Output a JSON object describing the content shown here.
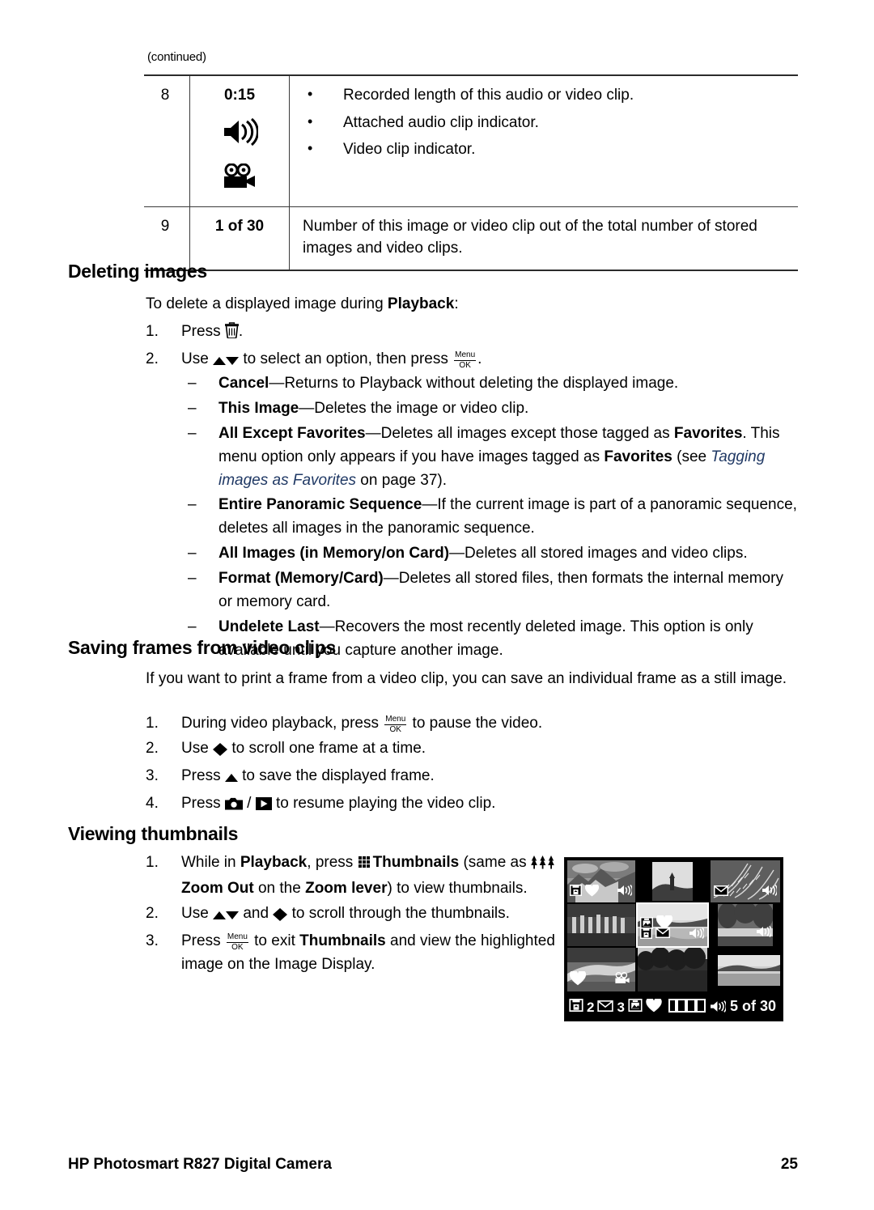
{
  "page": {
    "continued_label": "(continued)",
    "number": "25",
    "footer_title": "HP Photosmart R827 Digital Camera"
  },
  "table": {
    "rows": [
      {
        "num": "8",
        "value": "0:15",
        "icons": [
          "speaker-icon",
          "video-camera-icon"
        ],
        "bullets": [
          "Recorded length of this audio or video clip.",
          "Attached audio clip indicator.",
          "Video clip indicator."
        ]
      },
      {
        "num": "9",
        "value": "1 of 30",
        "icons": [],
        "description": "Number of this image or video clip out of the total number of stored images and video clips."
      }
    ]
  },
  "deleting_images": {
    "heading": "Deleting images",
    "intro_a": "To delete a displayed image during ",
    "intro_b": "Playback",
    "intro_c": ":",
    "steps": [
      {
        "num": "1.",
        "a": "Press ",
        "icon": "trash-icon",
        "b": "."
      },
      {
        "num": "2.",
        "a": "Use ",
        "icons": "up-down-arrows-icon",
        "b": " to select an option, then press ",
        "icon2": "menu-ok-icon",
        "c": "."
      }
    ],
    "options": [
      {
        "term": "Cancel",
        "dash": "—",
        "desc": "Returns to Playback without deleting the displayed image."
      },
      {
        "term": "This Image",
        "dash": "—",
        "desc": "Deletes the image or video clip."
      },
      {
        "term": "All Except Favorites",
        "dash": "—",
        "desc_a": "Deletes all images except those tagged as ",
        "bold_a": "Favorites",
        "desc_b": ". This menu option only appears if you have images tagged as ",
        "bold_b": "Favorites",
        "desc_c": " (see ",
        "link": "Tagging images as Favorites",
        "desc_d": " on page 37).",
        "link_page": "37"
      },
      {
        "term": "Entire Panoramic Sequence",
        "dash": "—",
        "desc": "If the current image is part of a panoramic sequence, deletes all images in the panoramic sequence."
      },
      {
        "term": "All Images (in Memory/on Card)",
        "dash": "—",
        "desc": "Deletes all stored images and video clips."
      },
      {
        "term": "Format (Memory/Card)",
        "dash": "—",
        "desc": "Deletes all stored files, then formats the internal memory or memory card."
      },
      {
        "term": "Undelete Last",
        "dash": "—",
        "desc": "Recovers the most recently deleted image. This option is only available until you capture another image."
      }
    ]
  },
  "saving_frames": {
    "heading": "Saving frames from video clips",
    "intro": "If you want to print a frame from a video clip, you can save an individual frame as a still image.",
    "steps": [
      {
        "num": "1.",
        "a": "During video playback, press ",
        "icon": "menu-ok-icon",
        "b": " to pause the video."
      },
      {
        "num": "2.",
        "a": "Use ",
        "icon": "left-right-arrows-icon",
        "b": " to scroll one frame at a time."
      },
      {
        "num": "3.",
        "a": "Press ",
        "icon": "up-arrow-icon",
        "b": " to save the displayed frame."
      },
      {
        "num": "4.",
        "a": "Press ",
        "icon": "camera-icon",
        "sep": " / ",
        "icon2": "playback-icon",
        "b": " to resume playing the video clip."
      }
    ]
  },
  "viewing_thumbnails": {
    "heading": "Viewing thumbnails",
    "steps": [
      {
        "num": "1.",
        "a": "While in ",
        "bold_a": "Playback",
        "b": ", press ",
        "icon": "thumbnails-grid-icon",
        "bold_b": "Thumbnails",
        "c": " (same as ",
        "icon2": "zoom-out-trees-icon",
        "bold_c": "Zoom Out",
        "d": " on the ",
        "bold_d": "Zoom lever",
        "e": ") to view thumbnails."
      },
      {
        "num": "2.",
        "a": "Use ",
        "icon": "up-down-arrows-icon",
        "b": " and ",
        "icon2": "left-right-arrows-icon",
        "c": " to scroll through the thumbnails."
      },
      {
        "num": "3.",
        "a": "Press ",
        "icon": "menu-ok-icon",
        "b": " to exit ",
        "bold_a": "Thumbnails",
        "c": " and view the highlighted image on the Image Display."
      }
    ]
  },
  "camera_screen": {
    "status": {
      "print_count": "2",
      "email_count": "3",
      "share_icon": "share-icon",
      "favorite_icon": "heart-icon",
      "filmstrip_icon": "filmstrip-icon",
      "audio_icon": "speaker-icon",
      "image_position": "5 of 30"
    },
    "thumbnails": [
      {
        "id": 1,
        "tone": "mountains",
        "icons": [
          "print-icon",
          "heart-icon",
          "speaker-icon"
        ],
        "selected": false
      },
      {
        "id": 2,
        "tone": "tower",
        "icons": [],
        "selected": false
      },
      {
        "id": 3,
        "tone": "fern",
        "icons": [
          "email-icon",
          "speaker-icon"
        ],
        "selected": false
      },
      {
        "id": 4,
        "tone": "ruins",
        "icons": [],
        "selected": false
      },
      {
        "id": 5,
        "tone": "coast",
        "icons": [
          "share-icon",
          "heart-icon",
          "print-icon",
          "email-icon",
          "speaker-icon"
        ],
        "selected": true
      },
      {
        "id": 6,
        "tone": "forest",
        "icons": [
          "speaker-icon"
        ],
        "selected": false
      },
      {
        "id": 7,
        "tone": "bridge",
        "icons": [
          "heart-icon",
          "video-camera-icon"
        ],
        "selected": false
      },
      {
        "id": 8,
        "tone": "palms",
        "icons": [],
        "selected": false
      },
      {
        "id": 9,
        "tone": "lake",
        "icons": [],
        "selected": false
      }
    ]
  },
  "colors": {
    "link": "#1f3864",
    "rule": "#2b2b2b",
    "text": "#000000",
    "page_bg": "#ffffff"
  }
}
